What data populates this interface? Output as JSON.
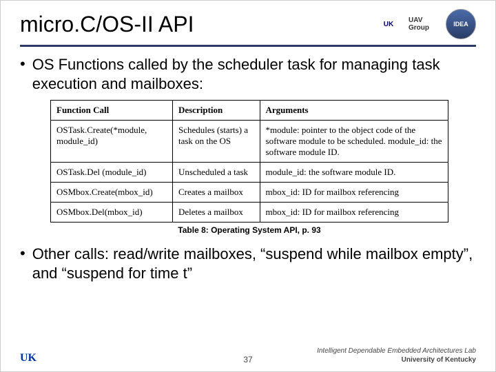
{
  "header": {
    "title": "micro.C/OS-II API",
    "logos": {
      "uk": "UK",
      "uav": "UAV Group",
      "idea": "IDEA"
    }
  },
  "bullets": {
    "b1": "OS Functions called by the scheduler task for managing task execution and mailboxes:",
    "b2": "Other calls: read/write mailboxes, “suspend while mailbox empty”, and “suspend for time t”"
  },
  "table": {
    "headers": {
      "c0": "Function Call",
      "c1": "Description",
      "c2": "Arguments"
    },
    "rows": [
      {
        "c0": "OSTask.Create(*module, module_id)",
        "c1": "Schedules (starts) a task on the OS",
        "c2": "*module: pointer to the object code of the software module to be scheduled. module_id: the software module ID."
      },
      {
        "c0": "OSTask.Del (module_id)",
        "c1": "Unscheduled  a task",
        "c2": "module_id: the software module ID."
      },
      {
        "c0": "OSMbox.Create(mbox_id)",
        "c1": "Creates a mailbox",
        "c2": "mbox_id: ID for mailbox referencing"
      },
      {
        "c0": "OSMbox.Del(mbox_id)",
        "c1": "Deletes a mailbox",
        "c2": "mbox_id: ID for mailbox referencing"
      }
    ],
    "caption": "Table 8: Operating System API, p. 93"
  },
  "footer": {
    "left": "UK",
    "page": "37",
    "lab": "Intelligent Dependable Embedded Architectures Lab",
    "uni": "University of Kentucky"
  }
}
